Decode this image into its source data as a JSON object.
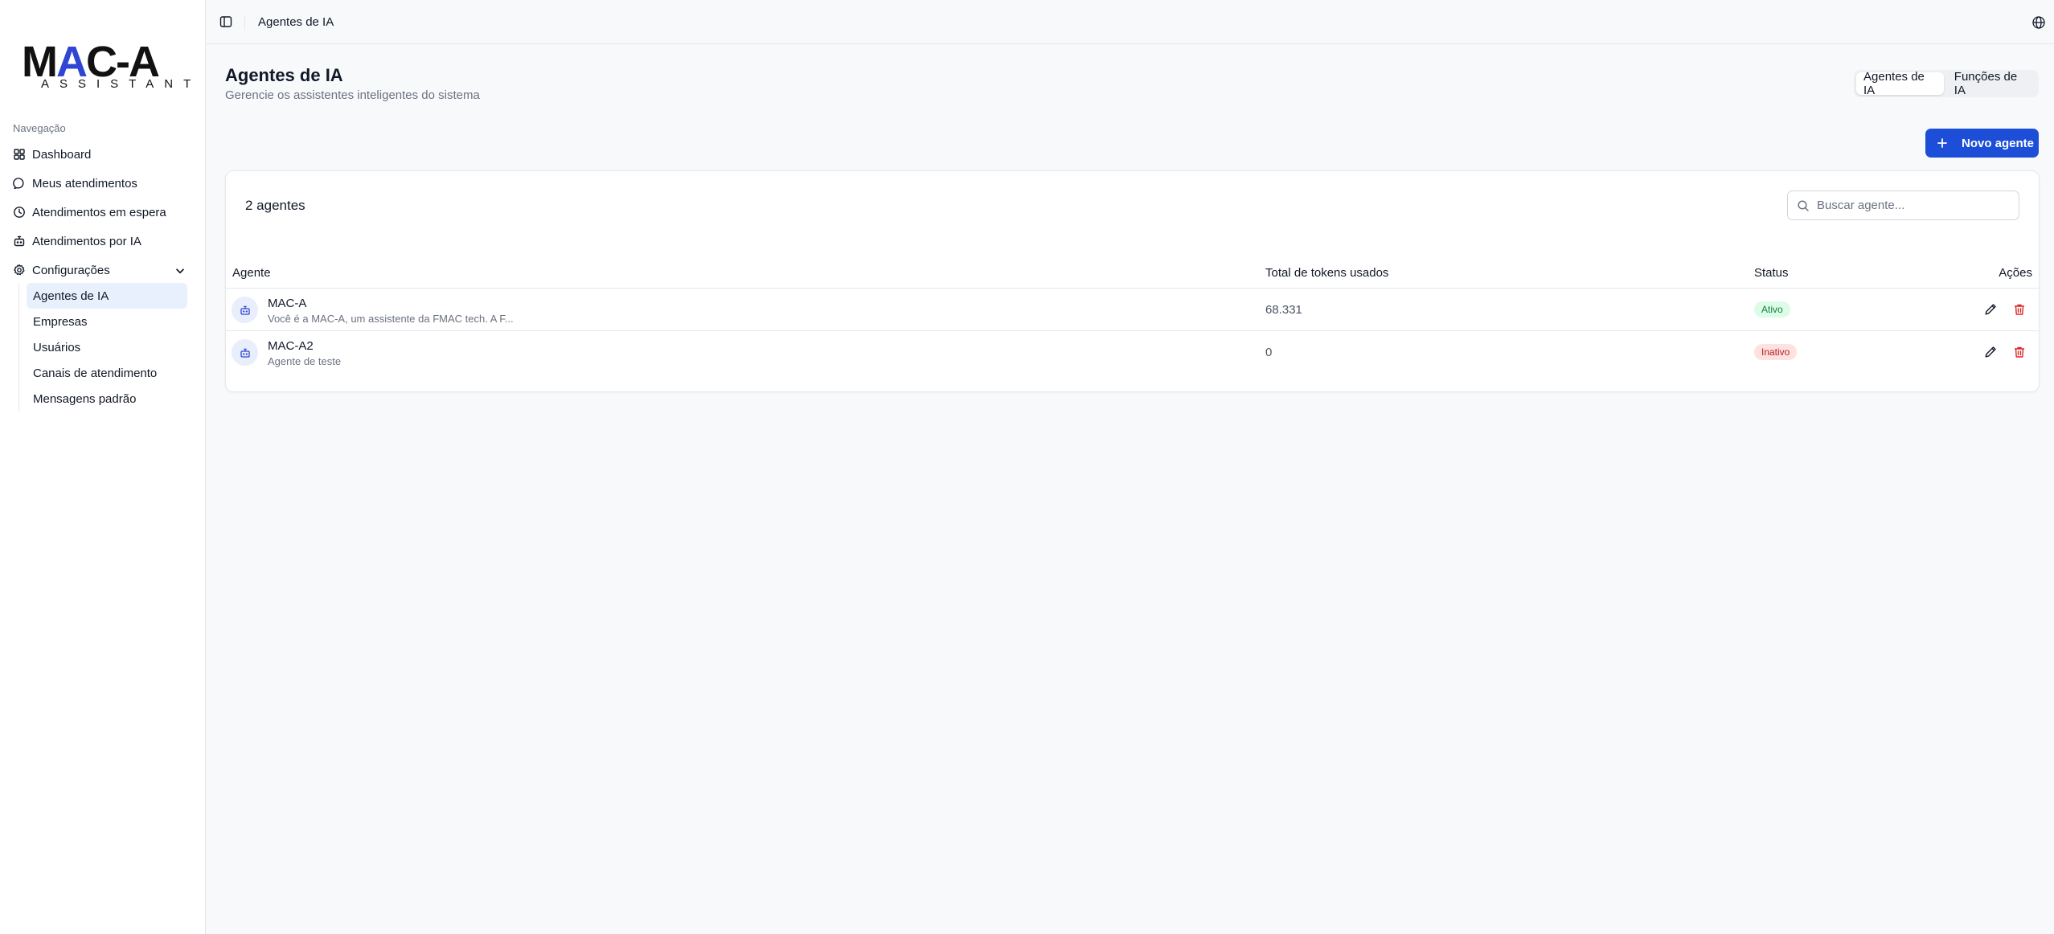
{
  "brand": {
    "logo_text": "MAC-A",
    "logo_sub": "ASSISTANT",
    "accent": "#2f45d4"
  },
  "sidebar": {
    "nav_label": "Navegação",
    "items": [
      {
        "label": "Dashboard",
        "icon": "grid-icon"
      },
      {
        "label": "Meus atendimentos",
        "icon": "message-icon"
      },
      {
        "label": "Atendimentos em espera",
        "icon": "clock-icon"
      },
      {
        "label": "Atendimentos por IA",
        "icon": "bot-icon"
      },
      {
        "label": "Configurações",
        "icon": "gear-icon",
        "expanded": true
      }
    ],
    "sub_items": [
      {
        "label": "Agentes de IA",
        "active": true
      },
      {
        "label": "Empresas"
      },
      {
        "label": "Usuários"
      },
      {
        "label": "Canais de atendimento"
      },
      {
        "label": "Mensagens padrão"
      }
    ]
  },
  "topbar": {
    "title": "Agentes de IA"
  },
  "header": {
    "title": "Agentes de IA",
    "subtitle": "Gerencie os assistentes inteligentes do sistema",
    "tabs": [
      {
        "label": "Agentes de IA",
        "active": true
      },
      {
        "label": "Funções de IA"
      }
    ],
    "new_button": "Novo agente"
  },
  "table": {
    "count_label": "2 agentes",
    "search_placeholder": "Buscar agente...",
    "columns": [
      "Agente",
      "Total de tokens usados",
      "Status",
      "Ações"
    ],
    "rows": [
      {
        "name": "MAC-A",
        "description": "Você é a MAC-A, um assistente da FMAC tech. A F...",
        "tokens": "68.331",
        "status": "Ativo"
      },
      {
        "name": "MAC-A2",
        "description": "Agente de teste",
        "tokens": "0",
        "status": "Inativo"
      }
    ]
  },
  "colors": {
    "primary": "#1d4ed8",
    "active_status": "#15803d",
    "inactive_status": "#b91c1c",
    "delete": "#dc2626"
  }
}
